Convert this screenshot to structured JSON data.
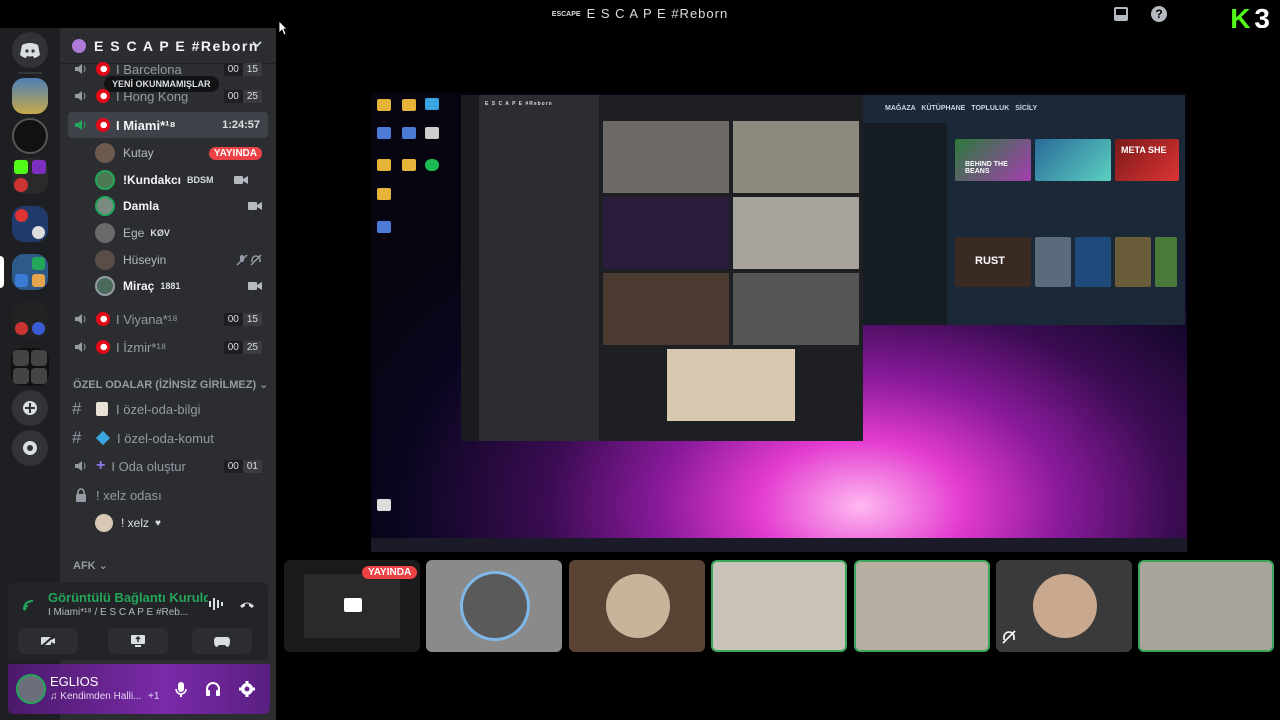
{
  "window": {
    "title": "E S C A P E #Reborn",
    "brand_mark": "ESCAPE"
  },
  "overlay": {
    "logo_letter": "K",
    "logo_number": "3"
  },
  "server": {
    "name": "E S C A P E #Reborn"
  },
  "pill": {
    "label": "YENİ OKUNMAMIŞLAR"
  },
  "channels": {
    "barcelona": {
      "name": "I Barcelona",
      "count_a": "00",
      "count_b": "15"
    },
    "hongkong": {
      "name": "I Hong Kong",
      "count_a": "00",
      "count_b": "25"
    },
    "miami": {
      "name": "I Miami*¹⁸",
      "timer": "1:24:57"
    },
    "viyana": {
      "name": "I Viyana*¹⁸",
      "count_a": "00",
      "count_b": "15"
    },
    "izmir": {
      "name": "I İzmir*¹⁸",
      "count_a": "00",
      "count_b": "25"
    },
    "category_private": "ÖZEL ODALAR (İZİNSİZ GİRİLMEZ)",
    "ozel_bilgi": {
      "name": "I özel-oda-bilgi"
    },
    "ozel_komut": {
      "name": "I özel-oda-komut"
    },
    "oda_olustur": {
      "name": "I Oda oluştur",
      "count_a": "00",
      "count_b": "01"
    },
    "xelz": {
      "name": "! xelz odası"
    },
    "category_afk": "AFK"
  },
  "miami_users": [
    {
      "name": "Kutay",
      "badge": "YAYINDA"
    },
    {
      "name": "!Kundakcı",
      "tag": "BDSM"
    },
    {
      "name": "Damla"
    },
    {
      "name": "Ege",
      "tag": "KØV"
    },
    {
      "name": "Hüseyin"
    },
    {
      "name": "Miraç",
      "tag": "1881"
    }
  ],
  "xelz_user": {
    "name": "! xelz"
  },
  "voice": {
    "status": "Görüntülü Bağlantı Kuruldu",
    "location": "I Miami*¹⁸ / E S C A P E #Reb..."
  },
  "user_panel": {
    "name": "EGLIOS",
    "status": "♫ Kendimden Halli...",
    "extra": "+1"
  },
  "stream": {
    "inner_server": "E S C A P E #Reborn",
    "steam_nav": "MAĞAZA KÜTÜPHANE TOPLULUK SİCİLY",
    "game_behind": "BEHIND THE BEANS",
    "game_rust": "RUST",
    "game_meta": "META SHE"
  },
  "strip": {
    "live_badge": "YAYINDA"
  },
  "colors": {
    "accent_green": "#23a55a",
    "live_red": "#ed4245",
    "kick_green": "#53fc18"
  }
}
